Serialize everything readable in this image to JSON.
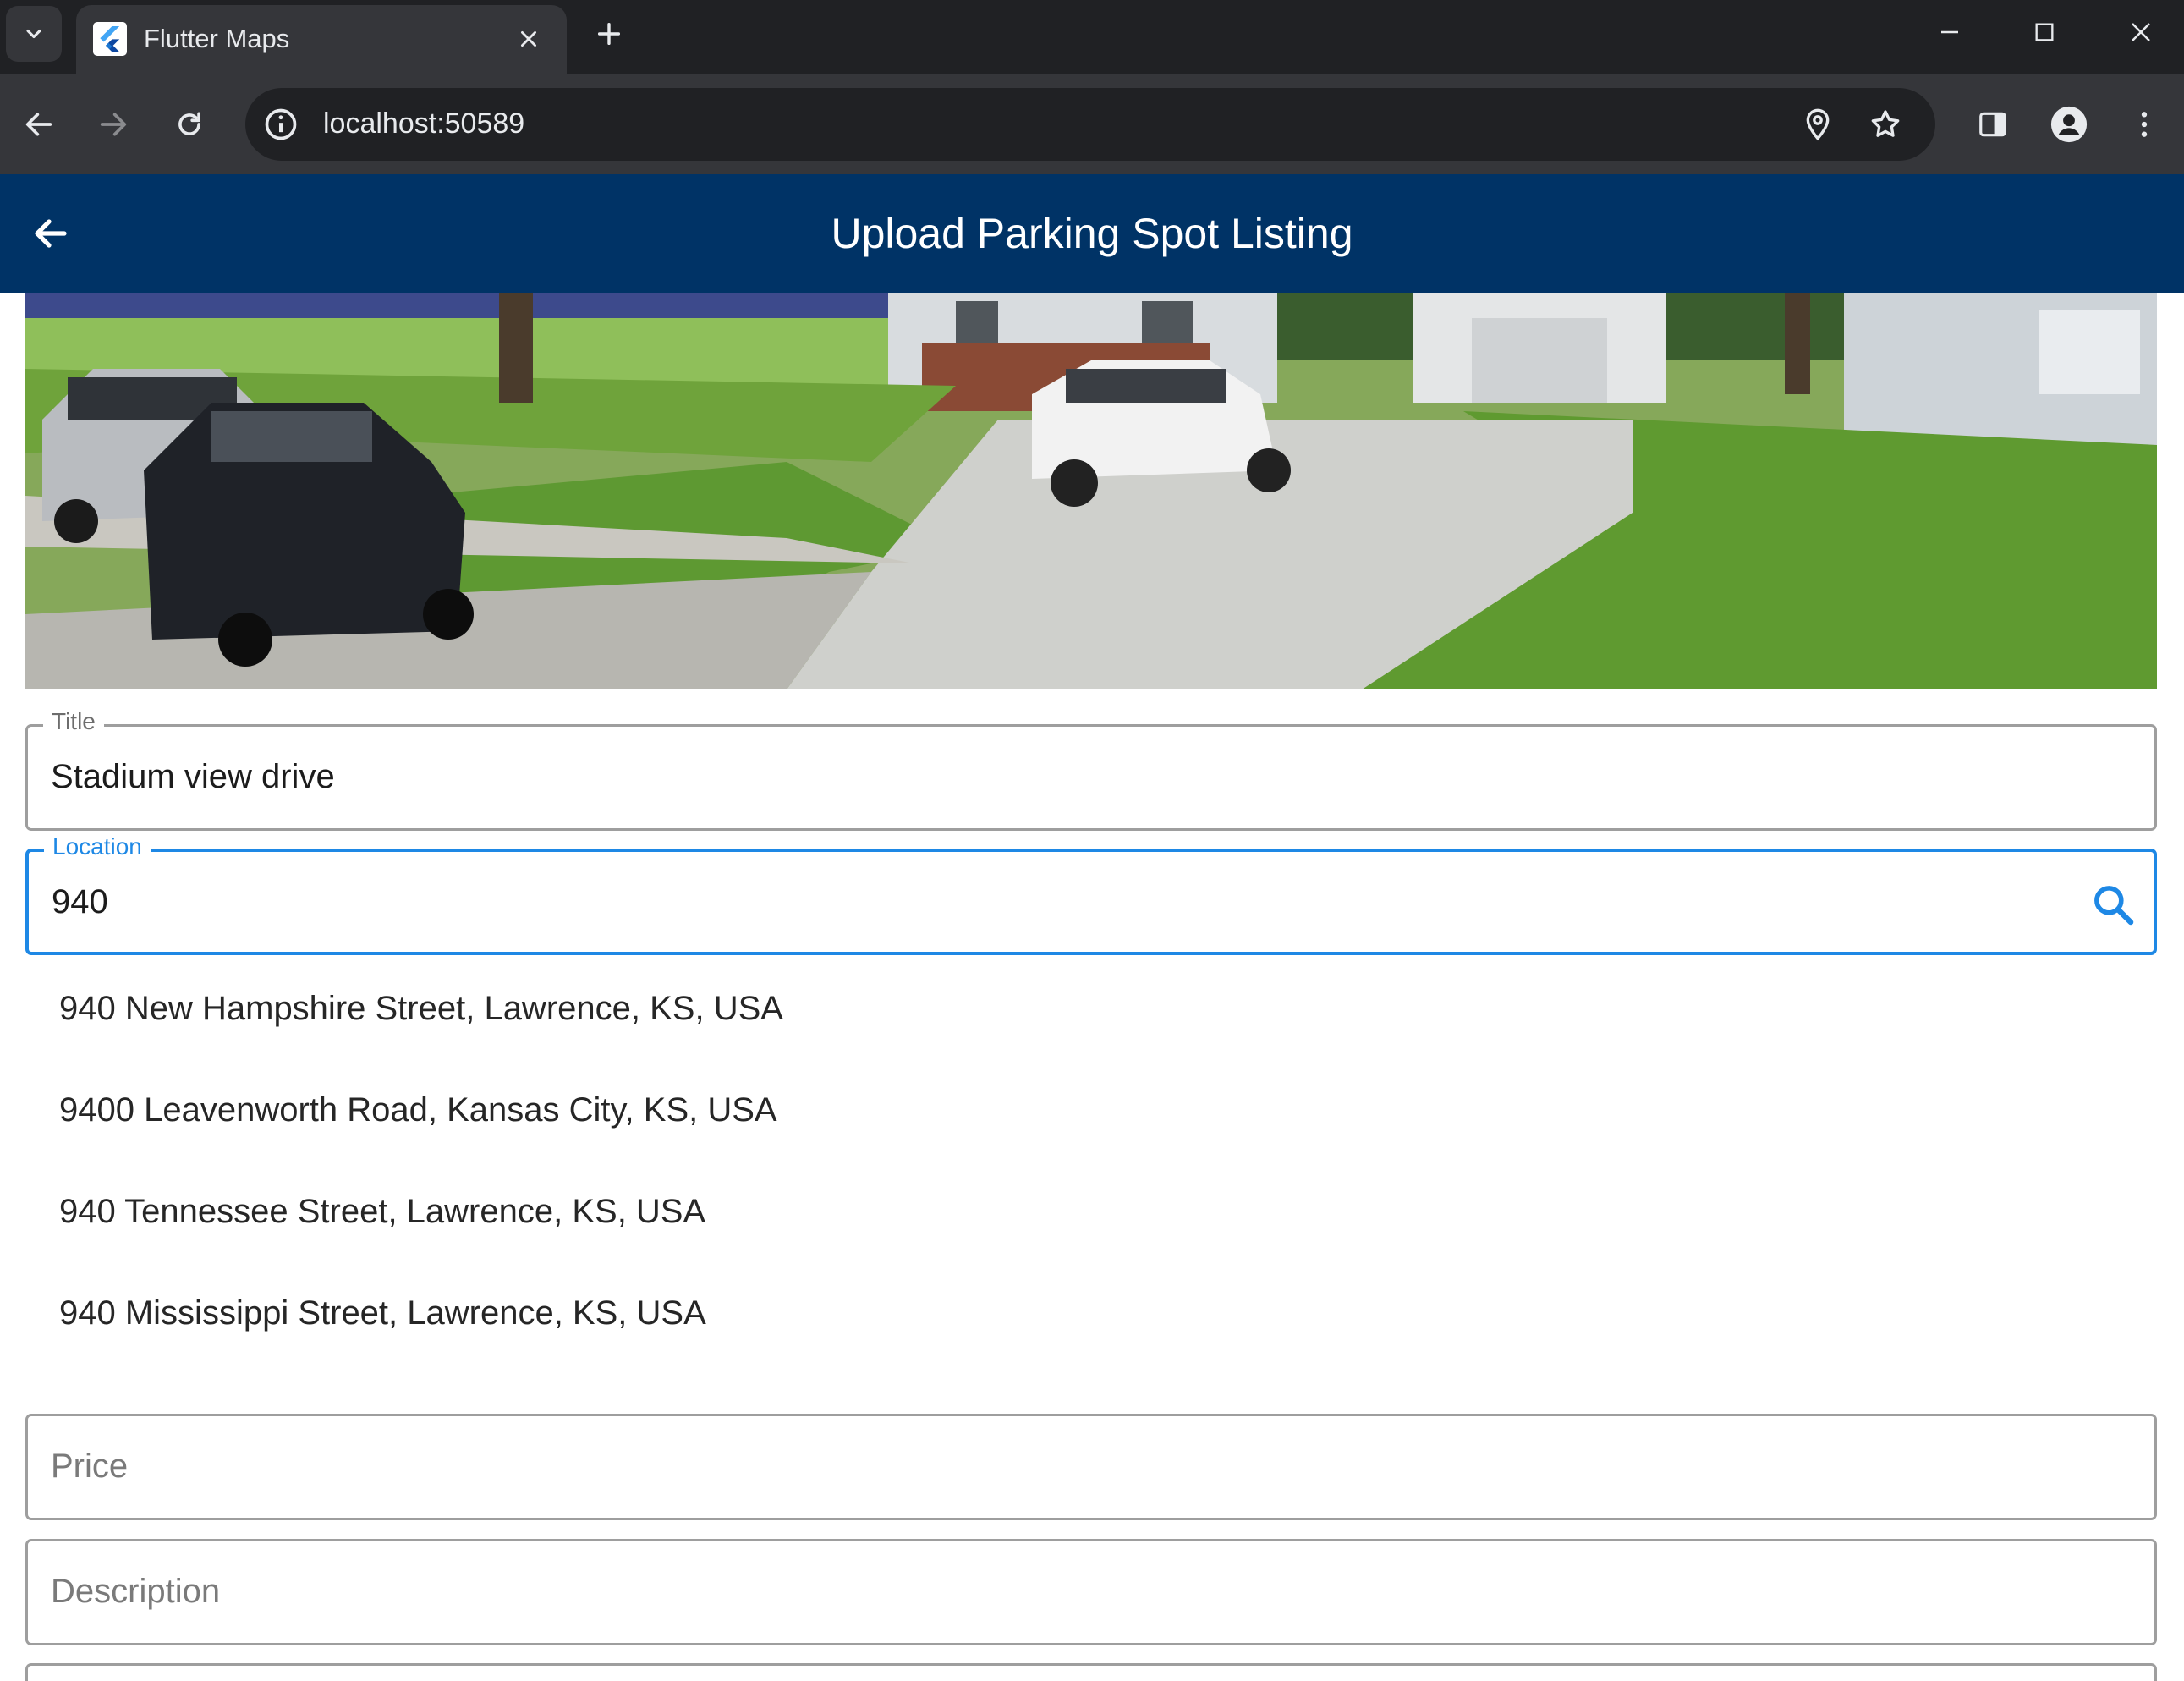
{
  "browser": {
    "tab_title": "Flutter Maps",
    "url": "localhost:50589"
  },
  "app": {
    "title": "Upload Parking Spot Listing"
  },
  "photo": {
    "icon": "parking-spot-photo"
  },
  "form": {
    "title": {
      "label": "Title",
      "value": "Stadium view drive"
    },
    "location": {
      "label": "Location",
      "value": "940"
    },
    "price": {
      "placeholder": "Price"
    },
    "description": {
      "placeholder": "Description"
    }
  },
  "suggestions": [
    "940 New Hampshire Street, Lawrence, KS, USA",
    "9400 Leavenworth Road, Kansas City, KS, USA",
    "940 Tennessee Street, Lawrence, KS, USA",
    "940 Mississippi Street, Lawrence, KS, USA"
  ],
  "colors": {
    "appbar": "#003366",
    "focus": "#1e88e5",
    "chrome_dark": "#202124",
    "chrome_toolbar": "#35363a"
  }
}
